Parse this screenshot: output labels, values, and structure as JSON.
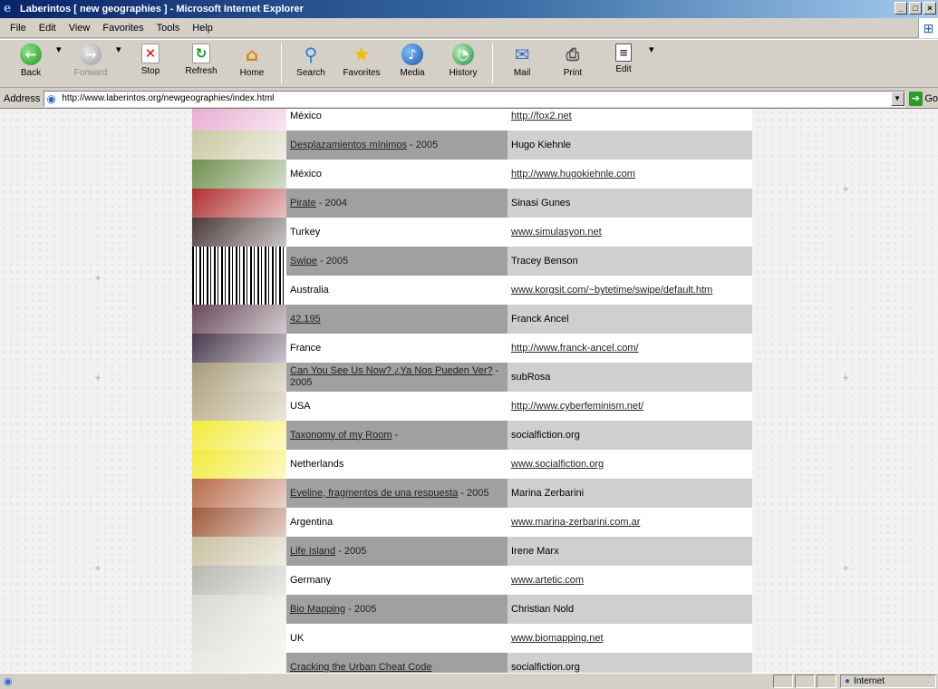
{
  "window": {
    "title": "Laberintos [ new geographies ] - Microsoft Internet Explorer"
  },
  "menu": [
    {
      "label": "File"
    },
    {
      "label": "Edit"
    },
    {
      "label": "View"
    },
    {
      "label": "Favorites"
    },
    {
      "label": "Tools"
    },
    {
      "label": "Help"
    }
  ],
  "toolbar": {
    "back": "Back",
    "forward": "Forward",
    "stop": "Stop",
    "refresh": "Refresh",
    "home": "Home",
    "search": "Search",
    "favorites": "Favorites",
    "media": "Media",
    "history": "History",
    "mail": "Mail",
    "print": "Print",
    "edit": "Edit"
  },
  "address": {
    "label": "Address",
    "url": "http://www.laberintos.org/newgeographies/index.html",
    "go": "Go"
  },
  "rows": [
    {
      "title": "México",
      "link_title": false,
      "author": "http://fox2.net",
      "link_author": true,
      "thumb": "#e8a8d0"
    },
    {
      "title": "Desplazamientos mínimos",
      "year": "- 2005",
      "link_title": true,
      "author": "Hugo Kiehnle",
      "link_author": false,
      "thumb": "#c9c7a0"
    },
    {
      "title": "México",
      "link_title": false,
      "author": "http://www.hugokiehnle.com",
      "link_author": true,
      "thumb": "#6f8f4e"
    },
    {
      "title": "Pirate",
      "year": "- 2004",
      "link_title": true,
      "author": "Sinasi Gunes",
      "link_author": false,
      "thumb": "#b03030"
    },
    {
      "title": "Turkey",
      "link_title": false,
      "author": "www.simulasyon.net",
      "link_author": true,
      "thumb": "#4a3a3a"
    },
    {
      "title": "Swipe",
      "year": "- 2005",
      "link_title": true,
      "author": "Tracey Benson",
      "link_author": false,
      "thumb": "barcode"
    },
    {
      "title": "Australia",
      "link_title": false,
      "author": "www.korgsit.com/~bytetime/swipe/default.htm",
      "link_author": true,
      "thumb": "barcode"
    },
    {
      "title": "42.195",
      "year": "",
      "link_title": true,
      "author": "Franck Ancel",
      "link_author": false,
      "thumb": "#6a4a5a"
    },
    {
      "title": "France",
      "link_title": false,
      "author": "http://www.franck-ancel.com/",
      "link_author": true,
      "thumb": "#4a3a50"
    },
    {
      "title": "Can You See Us Now? ¿Ya Nos Pueden Ver?",
      "year": "- 2005",
      "link_title": true,
      "author": "subRosa",
      "link_author": false,
      "thumb": "#a89a78"
    },
    {
      "title": "USA",
      "link_title": false,
      "author": "http://www.cyberfeminism.net/",
      "link_author": true,
      "thumb": "#b8aa88"
    },
    {
      "title": "Taxonomy of my Room",
      "year": "-",
      "link_title": true,
      "author": "socialfiction.org",
      "link_author": false,
      "thumb": "#f2ea3a"
    },
    {
      "title": "Netherlands",
      "link_title": false,
      "author": "www.socialfiction.org",
      "link_author": true,
      "thumb": "#f2ea3a"
    },
    {
      "title": "Eveline, fragmentos de una respuesta",
      "year": "- 2005",
      "link_title": true,
      "author": "Marina Zerbarini",
      "link_author": false,
      "thumb": "#b86a4a"
    },
    {
      "title": "Argentina",
      "link_title": false,
      "author": "www.marina-zerbarini.com.ar",
      "link_author": true,
      "thumb": "#a05a3a"
    },
    {
      "title": "Life Island",
      "year": "- 2005",
      "link_title": true,
      "author": "Irene Marx",
      "link_author": false,
      "thumb": "#c8c0a0"
    },
    {
      "title": "Germany",
      "link_title": false,
      "author": "www.artetic.com",
      "link_author": true,
      "thumb": "#b8b8b0"
    },
    {
      "title": "Bio Mapping",
      "year": "- 2005",
      "link_title": true,
      "author": "Christian Nold",
      "link_author": false,
      "thumb": "#d8d8d0"
    },
    {
      "title": "UK",
      "link_title": false,
      "author": "www.biomapping.net",
      "link_author": true,
      "thumb": "#e0e0d8"
    },
    {
      "title": "Cracking the Urban Cheat Code",
      "year": "",
      "link_title": true,
      "author": "socialfiction.org",
      "link_author": false,
      "thumb": "#e8e8e0"
    }
  ],
  "status": {
    "zone": "Internet"
  },
  "colors": {
    "title_bar": "#0a246a",
    "chrome": "#d4d0c8",
    "row_dark": "#a0a0a0",
    "row_light": "#cfcfcf"
  }
}
